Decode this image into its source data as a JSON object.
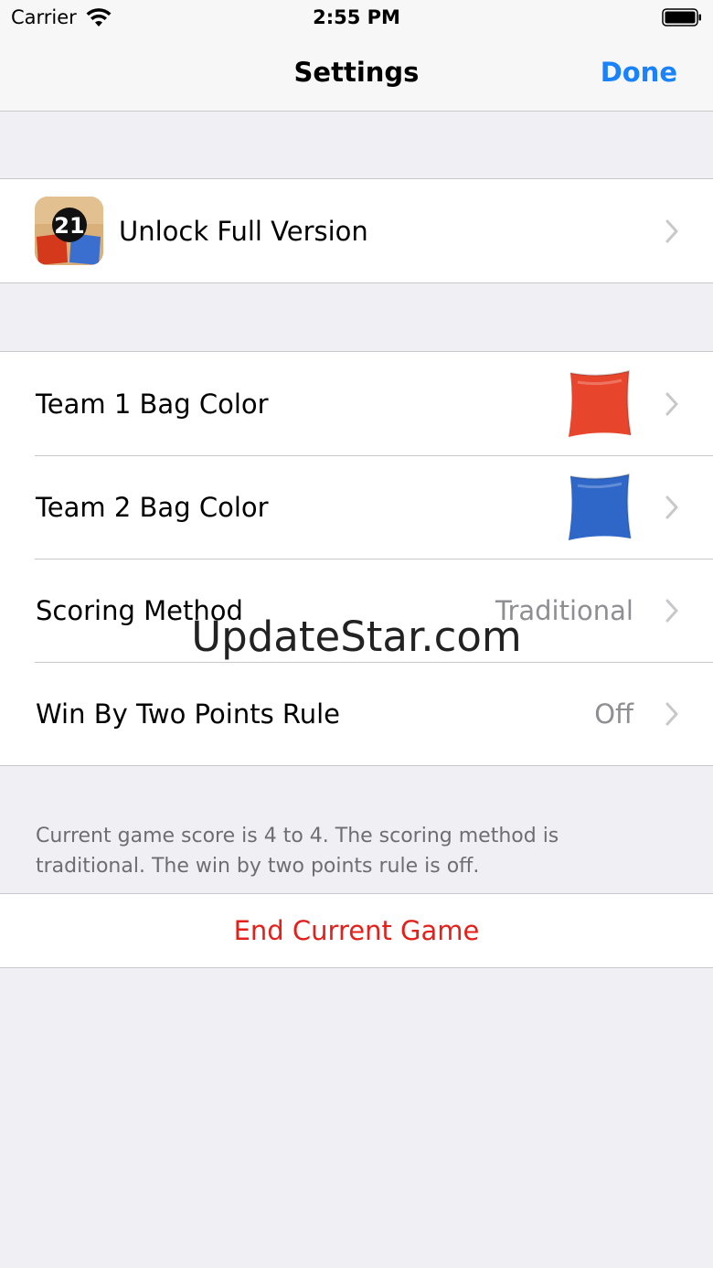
{
  "status_bar": {
    "carrier": "Carrier",
    "time": "2:55 PM",
    "icons": [
      "wifi-icon",
      "battery-icon"
    ]
  },
  "nav": {
    "title": "Settings",
    "done_label": "Done"
  },
  "unlock": {
    "label": "Unlock Full Version",
    "app_icon_text": "21"
  },
  "settings": [
    {
      "label": "Team 1 Bag Color",
      "swatch_color": "#e8462c"
    },
    {
      "label": "Team 2 Bag Color",
      "swatch_color": "#2e67c8"
    },
    {
      "label": "Scoring Method",
      "value": "Traditional"
    },
    {
      "label": "Win By Two Points Rule",
      "value": "Off"
    }
  ],
  "footer_note": "Current game score is 4 to 4. The scoring method is traditional. The win by two points rule is off.",
  "end_game_label": "End Current Game",
  "watermark": "UpdateStar.com",
  "colors": {
    "accent": "#1a82fb",
    "destructive": "#e3201b",
    "secondary_text": "#8e8e93",
    "background": "#efeff4"
  }
}
